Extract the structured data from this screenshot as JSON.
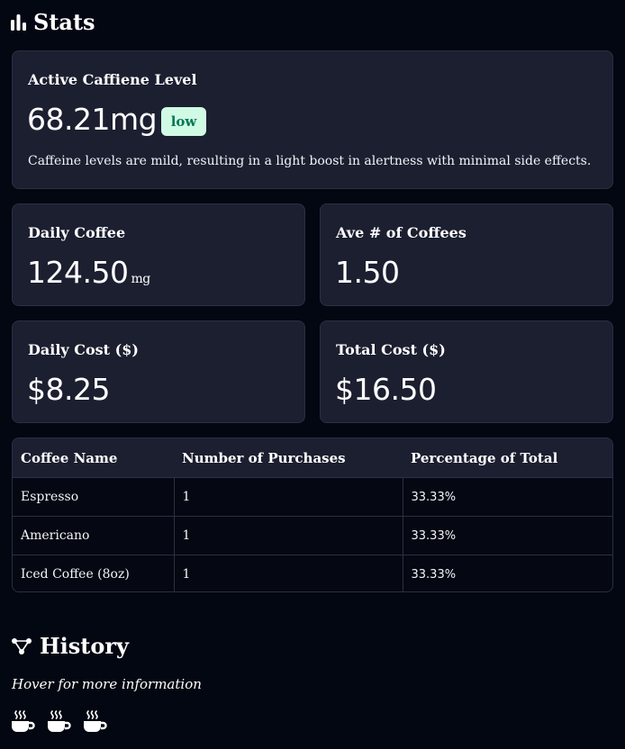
{
  "stats": {
    "title": "Stats",
    "icon": "bar-chart-icon",
    "caffeine": {
      "label": "Active Caffiene Level",
      "value": "68.21mg",
      "badge": "low",
      "badge_color": "#d1fae5",
      "description": "Caffeine levels are mild, resulting in a light boost in alertness with minimal side effects."
    },
    "daily_coffee": {
      "label": "Daily Coffee",
      "value": "124.50",
      "unit": "mg"
    },
    "ave_coffees": {
      "label": "Ave # of Coffees",
      "value": "1.50"
    },
    "daily_cost": {
      "label": "Daily Cost ($)",
      "value": "$8.25"
    },
    "total_cost": {
      "label": "Total Cost ($)",
      "value": "$16.50"
    },
    "table": {
      "headers": [
        "Coffee Name",
        "Number of Purchases",
        "Percentage of Total"
      ],
      "rows": [
        [
          "Espresso",
          "1",
          "33.33%"
        ],
        [
          "Americano",
          "1",
          "33.33%"
        ],
        [
          "Iced Coffee (8oz)",
          "1",
          "33.33%"
        ]
      ]
    }
  },
  "history": {
    "title": "History",
    "icon": "timeline-icon",
    "hint": "Hover for more information",
    "entries": [
      "coffee-cup-icon",
      "coffee-cup-icon",
      "coffee-cup-icon"
    ]
  }
}
